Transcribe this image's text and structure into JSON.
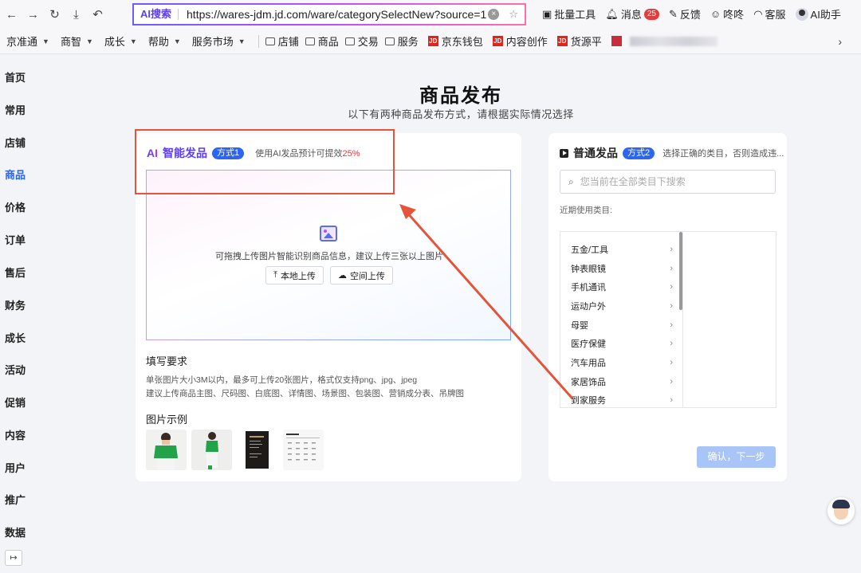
{
  "browser": {
    "nav_icons": [
      "back-icon",
      "forward-icon",
      "reload-icon",
      "download-icon",
      "undo-icon"
    ],
    "ai_search_label": "AI搜索",
    "url": "https://wares-jdm.jd.com/ware/categorySelectNew?source=1",
    "toolbar": {
      "batch_tools": "批量工具",
      "messages": "消息",
      "messages_count": "25",
      "feedback": "反馈",
      "dongdong": "咚咚",
      "service": "客服",
      "ai_assistant": "AI助手"
    }
  },
  "bookmarks": {
    "menus": [
      "京准通",
      "商智",
      "成长",
      "帮助",
      "服务市场"
    ],
    "folders": [
      "店铺",
      "商品",
      "交易",
      "服务"
    ],
    "jd_links": [
      "京东钱包",
      "内容创作",
      "货源平"
    ]
  },
  "sidebar": {
    "items": [
      "首页",
      "常用",
      "店铺",
      "商品",
      "价格",
      "订单",
      "售后",
      "财务",
      "成长",
      "活动",
      "促销",
      "内容",
      "用户",
      "推广",
      "数据"
    ],
    "active": "商品",
    "collapse_icon": "↦"
  },
  "page": {
    "title": "商品发布",
    "subtitle": "以下有两种商品发布方式，请根据实际情况选择"
  },
  "ai_card": {
    "logo": "AI",
    "title": "智能发品",
    "badge": "方式1",
    "desc_prefix": "使用AI发品预计可提效",
    "desc_highlight": "25%",
    "drop_text": "可拖拽上传图片智能识别商品信息，建议上传三张以上图片",
    "btn_local": "本地上传",
    "btn_space": "空间上传",
    "req_title": "填写要求",
    "req_line1": "单张图片大小3M以内，最多可上传20张图片，格式仅支持png、jpg、jpeg",
    "req_line2": "建议上传商品主图、尺码图、白底图、详情图、场景图、包装图、营销成分表、吊牌图",
    "example_title": "图片示例"
  },
  "normal_card": {
    "title": "普通发品",
    "badge": "方式2",
    "desc": "选择正确的类目，否则造成违...",
    "search_placeholder": "您当前在全部类目下搜索",
    "recent_label": "近期使用类目:",
    "categories": [
      "五金/工具",
      "钟表眼镜",
      "手机通讯",
      "运动户外",
      "母婴",
      "医疗保健",
      "汽车用品",
      "家居饰品",
      "到家服务"
    ],
    "confirm_label": "确认，下一步"
  },
  "colors": {
    "brand_blue": "#2b65f0",
    "annotation_red": "#e5533a",
    "ai_purple": "#5a3cff",
    "highlight_red": "#e23c3c"
  }
}
